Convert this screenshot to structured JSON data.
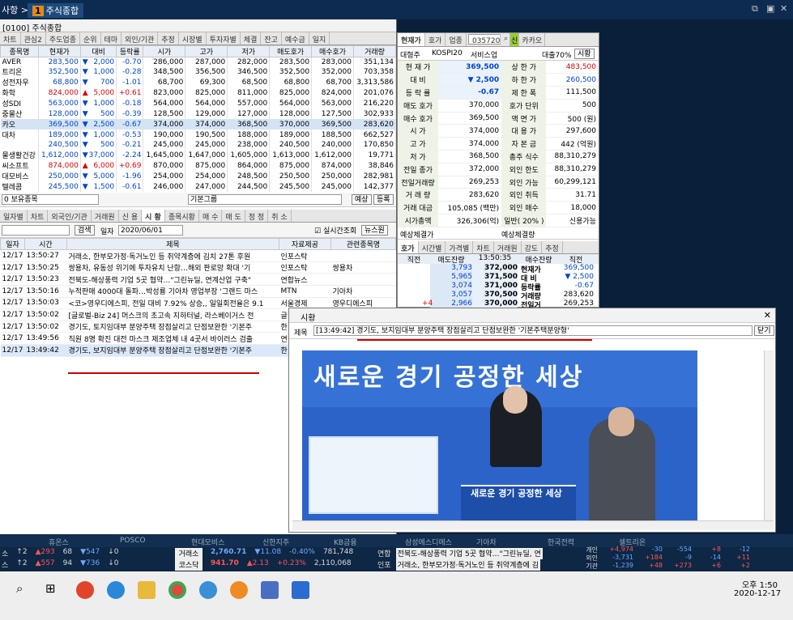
{
  "topbar": {
    "menu": "사항 >",
    "doc_num": "1",
    "doc_title": "주식종합",
    "icons": [
      "restore-icon",
      "popout-icon",
      "close-icon"
    ]
  },
  "main": {
    "title": "[0100] 주식종합",
    "tabs": [
      "차트",
      "관심2",
      "주도업종",
      "순위",
      "테마",
      "외인/기관",
      "추정",
      "시장별",
      "투자자별",
      "체결",
      "잔고",
      "예수금",
      "일지"
    ],
    "headers": [
      "종목명",
      "현재가",
      "대비",
      "등락률",
      "시가",
      "고가",
      "저가",
      "매도호가",
      "매수호가",
      "거래량"
    ],
    "rows": [
      {
        "name": "AVER",
        "price": "283,500",
        "dir": "▼",
        "diff": "2,000",
        "rate": "-0.70",
        "open": "286,000",
        "high": "287,000",
        "low": "282,000",
        "ask": "283,500",
        "bid": "283,000",
        "vol": "351,134",
        "c": "dn"
      },
      {
        "name": "트리온",
        "price": "352,500",
        "dir": "▼",
        "diff": "1,000",
        "rate": "-0.28",
        "open": "348,500",
        "high": "356,500",
        "low": "346,500",
        "ask": "352,500",
        "bid": "352,000",
        "vol": "703,358",
        "c": "dn"
      },
      {
        "name": "성전자우",
        "price": "68,800",
        "dir": "▼",
        "diff": "700",
        "rate": "-1.01",
        "open": "68,700",
        "high": "69,300",
        "low": "68,500",
        "ask": "68,800",
        "bid": "68,700",
        "vol": "3,313,586",
        "c": "dn"
      },
      {
        "name": "화학",
        "price": "824,000",
        "dir": "▲",
        "diff": "5,000",
        "rate": "+0.61",
        "open": "823,000",
        "high": "825,000",
        "low": "811,000",
        "ask": "825,000",
        "bid": "824,000",
        "vol": "201,076",
        "c": "up"
      },
      {
        "name": "성SDI",
        "price": "563,000",
        "dir": "▼",
        "diff": "1,000",
        "rate": "-0.18",
        "open": "564,000",
        "high": "564,000",
        "low": "557,000",
        "ask": "564,000",
        "bid": "563,000",
        "vol": "216,220",
        "c": "dn"
      },
      {
        "name": "중물산",
        "price": "128,000",
        "dir": "▼",
        "diff": "500",
        "rate": "-0.39",
        "open": "128,500",
        "high": "129,000",
        "low": "127,000",
        "ask": "128,000",
        "bid": "127,500",
        "vol": "302,933",
        "c": "dn"
      },
      {
        "name": "카오",
        "price": "369,500",
        "dir": "▼",
        "diff": "2,500",
        "rate": "-0.67",
        "open": "374,000",
        "high": "374,000",
        "low": "368,500",
        "ask": "370,000",
        "bid": "369,500",
        "vol": "283,620",
        "c": "dn",
        "sel": true
      },
      {
        "name": "대차",
        "price": "189,000",
        "dir": "▼",
        "diff": "1,000",
        "rate": "-0.53",
        "open": "190,000",
        "high": "190,500",
        "low": "188,000",
        "ask": "189,000",
        "bid": "188,500",
        "vol": "662,527",
        "c": "dn"
      },
      {
        "name": "",
        "price": "240,500",
        "dir": "▼",
        "diff": "500",
        "rate": "-0.21",
        "open": "245,000",
        "high": "245,000",
        "low": "238,000",
        "ask": "240,500",
        "bid": "240,000",
        "vol": "170,850",
        "c": "dn"
      },
      {
        "name": "물생활건강",
        "price": "1,612,000",
        "dir": "▼",
        "diff": "37,000",
        "rate": "-2.24",
        "open": "1,645,000",
        "high": "1,647,000",
        "low": "1,605,000",
        "ask": "1,613,000",
        "bid": "1,612,000",
        "vol": "19,771",
        "c": "dn"
      },
      {
        "name": "씨소프트",
        "price": "874,000",
        "dir": "▲",
        "diff": "6,000",
        "rate": "+0.69",
        "open": "870,000",
        "high": "875,000",
        "low": "864,000",
        "ask": "875,000",
        "bid": "874,000",
        "vol": "38,846",
        "c": "up"
      },
      {
        "name": "대모비스",
        "price": "250,000",
        "dir": "▼",
        "diff": "5,000",
        "rate": "-1.96",
        "open": "254,000",
        "high": "254,000",
        "low": "248,500",
        "ask": "250,500",
        "bid": "250,000",
        "vol": "282,981",
        "c": "dn"
      },
      {
        "name": "텔레콤",
        "price": "245,500",
        "dir": "▼",
        "diff": "1,500",
        "rate": "-0.61",
        "open": "246,000",
        "high": "247,000",
        "low": "244,500",
        "ask": "245,500",
        "bid": "245,000",
        "vol": "142,377",
        "c": "dn"
      }
    ],
    "groupbar": {
      "left": "0 보유종목",
      "mid": "기본그룹",
      "b1": "예상",
      "b2": "등록"
    },
    "news_tabs": [
      "일자별",
      "차트",
      "외국인/기관",
      "거래원",
      "신 용",
      "시 황",
      "종목시황",
      "매 수",
      "매 도",
      "정 정",
      "취 소"
    ],
    "news_ctrl": {
      "search": "검색",
      "date_label": "일자",
      "date": "2020/06/01",
      "realtime": "실시간조회",
      "news_btn": "뉴스원"
    },
    "news_headers": [
      "일자",
      "시간",
      "제목",
      "자료제공",
      "관련종목명"
    ],
    "news": [
      {
        "d": "12/17",
        "t": "13:50:27",
        "title": "거래소, 한부모가정·독거노인 등 취약계층에 김치 27톤 후원",
        "src": "인포스탁",
        "rel": ""
      },
      {
        "d": "12/17",
        "t": "13:50:25",
        "title": "쌍용차, 유동성 위기에 투자유치 난항…해외 판로망 확대 '기",
        "src": "인포스탁",
        "rel": "쌍용차"
      },
      {
        "d": "12/17",
        "t": "13:50:23",
        "title": "전북도-해상풍력 기업 5곳 협약…\"그린뉴딜, 연계산업 구축\"",
        "src": "연합뉴스",
        "rel": ""
      },
      {
        "d": "12/17",
        "t": "13:50:16",
        "title": "누적판매 4000대 돌파…박성룡 기아차 영업부장 '그랜드 마스",
        "src": "MTN",
        "rel": "기아차"
      },
      {
        "d": "12/17",
        "t": "13:50:03",
        "title": "<코>영우디에스피, 전일 대비 7.92% 상승,, 일일회전율은 9.1",
        "src": "서울경제",
        "rel": "영우디에스피"
      },
      {
        "d": "12/17",
        "t": "13:50:02",
        "title": "[글로벌-Biz 24] 머스크의 초고속 지하터널, 라스베이거스 전",
        "src": "글",
        "rel": ""
      },
      {
        "d": "12/17",
        "t": "13:50:02",
        "title": "경기도, 토지임대부 분양주택 장점살리고 단점보완한 '기본주",
        "src": "한",
        "rel": ""
      },
      {
        "d": "12/17",
        "t": "13:49:56",
        "title": "직원 8명 확진 대전 마스크 제조업체 내 4곳서 바이러스 검출",
        "src": "연",
        "rel": ""
      },
      {
        "d": "12/17",
        "t": "13:49:42",
        "title": "경기도, 보지임대부 분양주택 장점살리고 단점보완한 '기본주",
        "src": "한",
        "rel": "",
        "hl": true
      }
    ]
  },
  "right": {
    "tabs": [
      "현재가",
      "호가",
      "업종"
    ],
    "code": "035720",
    "name": "카카오",
    "badge": "신",
    "sub": {
      "a": "대형주",
      "b": "KOSPI20",
      "c": "서비스업",
      "d": "대출70%",
      "e": "시황"
    },
    "rows": [
      [
        "현 재 가",
        "369,500",
        "상 한 가",
        "483,500"
      ],
      [
        "대    비",
        "▼ 2,500",
        "하 한 가",
        "260,500"
      ],
      [
        "등 락 률",
        "-0.67",
        "제 한 폭",
        "111,500"
      ],
      [
        "매도 호가",
        "370,000",
        "호가 단위",
        "500"
      ],
      [
        "매수 호가",
        "369,500",
        "액 면 가",
        "500 (원)"
      ],
      [
        "시    가",
        "374,000",
        "대 용 가",
        "297,600"
      ],
      [
        "고    가",
        "374,000",
        "자 본 금",
        "442 (억원)"
      ],
      [
        "저    가",
        "368,500",
        "총주 식수",
        "88,310,279"
      ],
      [
        "전일 종가",
        "372,000",
        "외인 한도",
        "88,310,279"
      ],
      [
        "전일거래량",
        "269,253",
        "외인 가능",
        "60,299,121"
      ],
      [
        "거 래 량",
        "283,620",
        "외인 취득",
        "31.71"
      ],
      [
        "거래 대금",
        "105,085 (백만)",
        "외인 매수",
        "18,000"
      ],
      [
        "시가총액",
        "326,306(억)",
        "일반( 20% )",
        "신용가능"
      ]
    ],
    "expected": {
      "a": "예상체결가",
      "b": "예상체결량"
    },
    "tabs2": [
      "호가",
      "시간별",
      "가격별",
      "차트",
      "거래원",
      "강도",
      "추정"
    ],
    "ob_headers": [
      "직전",
      "매도잔량",
      "13:50:35",
      "매수잔량",
      "직전"
    ],
    "ob": [
      [
        "3,793",
        "372,000"
      ],
      [
        "5,965",
        "371,500"
      ],
      [
        "3,074",
        "371,000"
      ],
      [
        "3,057",
        "370,500"
      ],
      [
        "2,966",
        "370,000"
      ]
    ],
    "ob_side": [
      [
        "현재가",
        "369,500"
      ],
      [
        "대 비",
        "▼ 2,500"
      ],
      [
        "등락률",
        "-0.67"
      ],
      [
        "거래량",
        "283,620"
      ],
      [
        "전일거",
        "269,253"
      ]
    ],
    "ob_change": "+4"
  },
  "popup": {
    "title": "시황",
    "label": "제목",
    "headline": "[13:49:42] 경기도, 보지임대부 분양주택 장점살리고 단점보완한 '기본주택분양형'",
    "close_btn": "닫기",
    "banner": "새로운 경기  공정한 세상",
    "podium": "새로운 경기  공정한 세상"
  },
  "dock": {
    "tickers": [
      "휴온스",
      "POSCO",
      "현대모비스",
      "신한지주",
      "KB금융",
      "삼성에스디에스",
      "기아차",
      "한국전력",
      "셀트리온"
    ],
    "left1": [
      "소",
      "↑2",
      "▲293",
      "68",
      "▼547",
      "↓0"
    ],
    "left2": [
      "스",
      "↑2",
      "▲557",
      "94",
      "▼736",
      "↓0"
    ],
    "idx": [
      {
        "name": "거래소",
        "val": "2,760.71",
        "chg": "▼11.08",
        "pct": "-0.40%",
        "vol": "781,748",
        "c": "dn"
      },
      {
        "name": "코스닥",
        "val": "941.70",
        "chg": "▲2.13",
        "pct": "+0.23%",
        "vol": "2,110,068",
        "c": "up"
      }
    ],
    "news": [
      {
        "src": "연합",
        "txt": "전북도-해상풍력 기업 5곳 협약…\"그린뉴딜, 연"
      },
      {
        "src": "인포",
        "txt": "거래소, 한부모가정·독거노인 등 취약계층에 김"
      }
    ],
    "investor": [
      [
        "개인",
        "+4,974",
        "-30",
        "-554",
        "+8",
        "-12"
      ],
      [
        "외인",
        "-3,731",
        "+184",
        "-9",
        "-14",
        "+11"
      ],
      [
        "기관",
        "-1,239",
        "+48",
        "+273",
        "+6",
        "+2"
      ]
    ]
  },
  "taskbar": {
    "time": "오후 1:50",
    "date": "2020-12-17"
  }
}
